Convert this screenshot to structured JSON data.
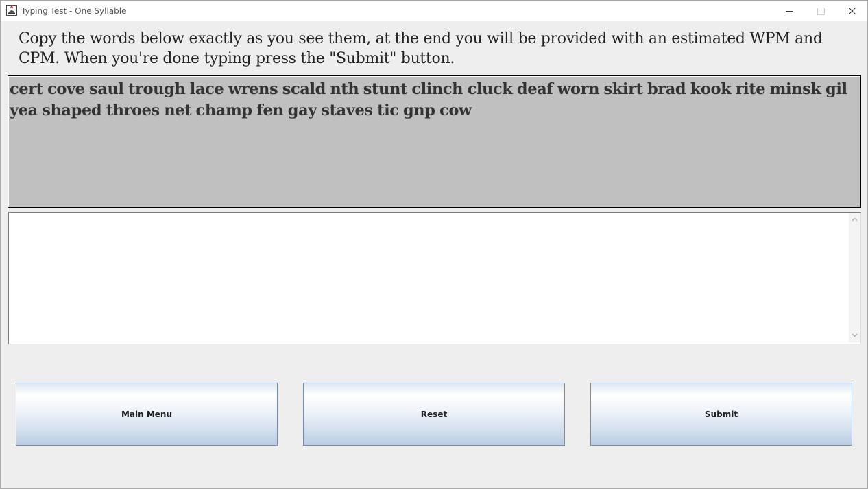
{
  "window": {
    "title": "Typing Test - One Syllable",
    "icon": "java-cup-icon"
  },
  "instructions": "Copy the words below exactly as you see them, at the end you will be provided with an estimated WPM and CPM. When you're done typing press the \"Submit\" button.",
  "prompt": {
    "words": "cert cove saul trough lace wrens scald nth stunt clinch cluck deaf worn skirt brad kook rite minsk gil yea shaped throes net champ fen gay staves tic gnp cow"
  },
  "input": {
    "value": ""
  },
  "buttons": {
    "main_menu": "Main Menu",
    "reset": "Reset",
    "submit": "Submit"
  },
  "colors": {
    "window_bg": "#eeeeee",
    "prompt_bg": "#c0c0c0",
    "button_gradient_bottom": "#b8cce3",
    "button_border": "#7a8ea8"
  }
}
